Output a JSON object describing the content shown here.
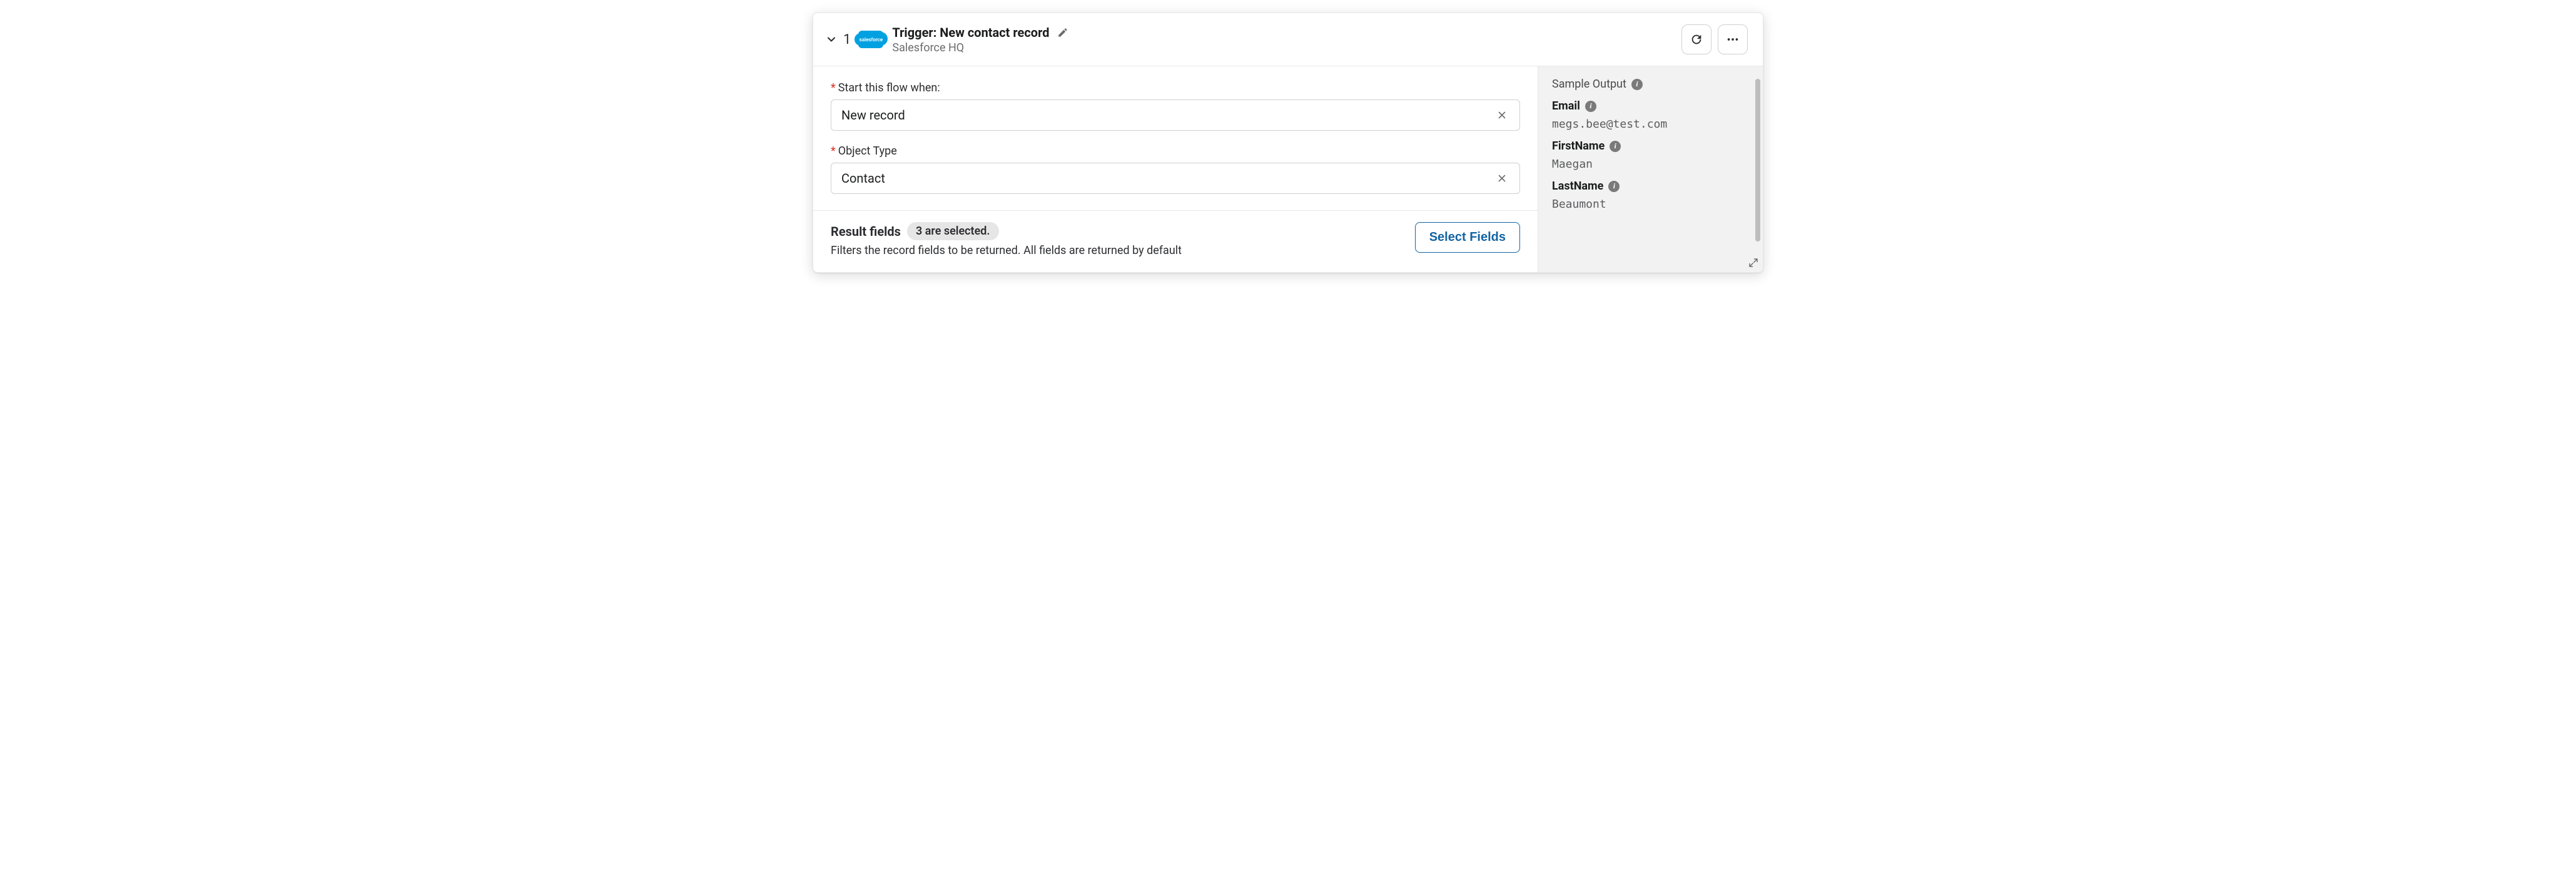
{
  "header": {
    "step_number": "1",
    "logo_text": "salesforce",
    "title": "Trigger: New contact record",
    "subtitle": "Salesforce HQ"
  },
  "form": {
    "start_label": "Start this flow when:",
    "start_value": "New record",
    "object_label": "Object Type",
    "object_value": "Contact"
  },
  "result": {
    "title": "Result fields",
    "badge": "3 are selected.",
    "description": "Filters the record fields to be returned. All fields are returned by default",
    "button": "Select Fields"
  },
  "sample": {
    "header": "Sample Output",
    "fields": [
      {
        "name": "Email",
        "value": "megs.bee@test.com"
      },
      {
        "name": "FirstName",
        "value": "Maegan"
      },
      {
        "name": "LastName",
        "value": "Beaumont"
      }
    ]
  }
}
